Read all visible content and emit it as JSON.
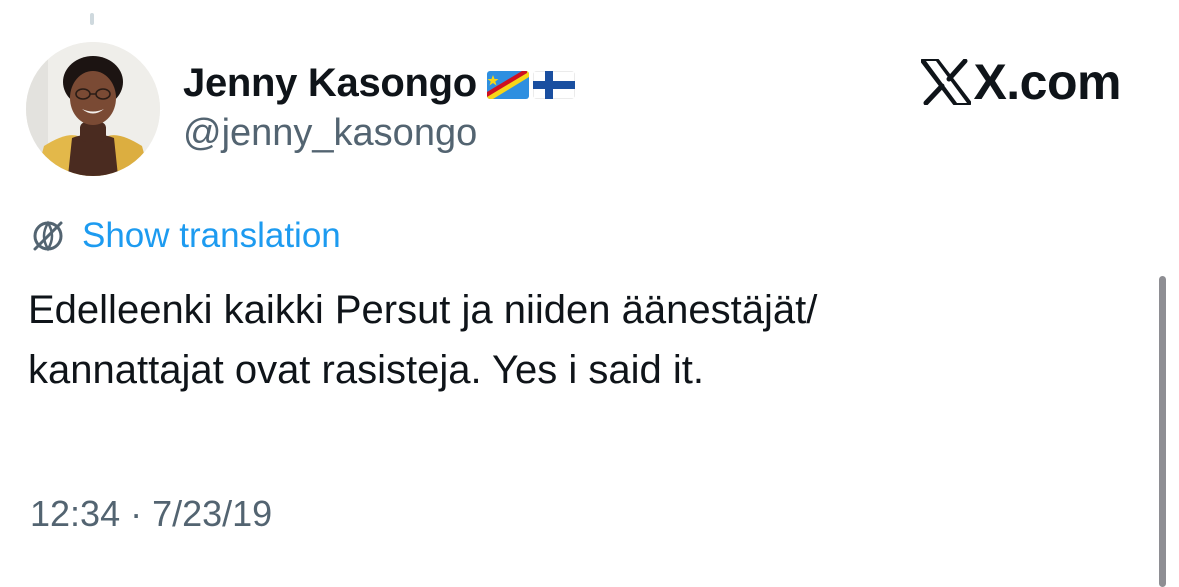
{
  "author": {
    "display_name": "Jenny Kasongo",
    "handle": "@jenny_kasongo",
    "flags": [
      "DR Congo flag",
      "Finland flag"
    ]
  },
  "brand": {
    "label": "X.com",
    "icon": "x-logo-icon"
  },
  "translate": {
    "icon": "globe-icon",
    "label": "Show translation"
  },
  "tweet": {
    "lines": [
      "Edelleenki kaikki Persut ja niiden äänestäjät/",
      "kannattajat ovat rasisteja. Yes i said it."
    ]
  },
  "meta": {
    "time": "12:34",
    "separator": "·",
    "date": "7/23/19"
  },
  "colors": {
    "link": "#1d9bf0",
    "secondary_text": "#536471",
    "primary_text": "#0f1419"
  }
}
